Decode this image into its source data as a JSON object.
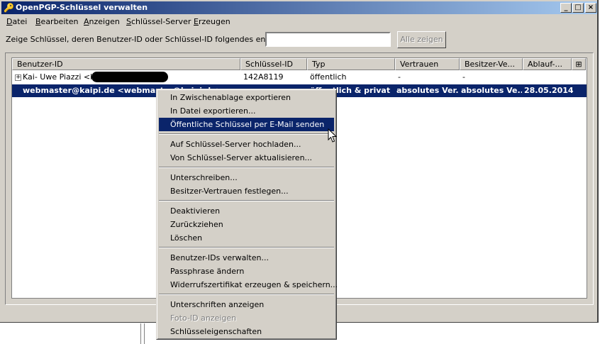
{
  "window": {
    "title": "OpenPGP-Schlüssel verwalten",
    "min": "_",
    "max": "□",
    "close": "×"
  },
  "menubar": [
    {
      "key": "D",
      "rest": "atei"
    },
    {
      "key": "B",
      "rest": "earbeiten"
    },
    {
      "key": "A",
      "rest": "nzeigen"
    },
    {
      "key": "S",
      "rest": "chlüssel-Server"
    },
    {
      "key": "E",
      "rest": "rzeugen"
    }
  ],
  "filter": {
    "label": "Zeige Schlüssel, deren Benutzer-ID oder Schlüssel-ID folgendes enthalten:",
    "value": "",
    "show_all": "Alle zeigen"
  },
  "columns": [
    "Benutzer-ID",
    "Schlüssel-ID",
    "Typ",
    "Vertrauen",
    "Besitzer-Ve...",
    "Ablauf-..."
  ],
  "rows": [
    {
      "expander": "+",
      "user": "Kai- Uwe Piazzi <kai-",
      "keyid": "142A8119",
      "type": "öffentlich",
      "trust": "-",
      "owner": "-",
      "expiry": ""
    },
    {
      "expander": "",
      "user": "webmaster@kaipi.de <webmaster@kaipi.de>",
      "keyid": "",
      "type": "öffentlich & privat",
      "trust": "absolutes Ver...",
      "owner": "absolutes Ve...",
      "expiry": "28.05.2014"
    }
  ],
  "context_menu": {
    "items": [
      "In Zwischenablage exportieren",
      "In Datei exportieren...",
      "Öffentliche Schlüssel per E-Mail senden",
      "Auf Schlüssel-Server hochladen...",
      "Von Schlüssel-Server aktualisieren...",
      "Unterschreiben...",
      "Besitzer-Vertrauen festlegen...",
      "Deaktivieren",
      "Zurückziehen",
      "Löschen",
      "Benutzer-IDs verwalten...",
      "Passphrase ändern",
      "Widerrufszertifikat erzeugen & speichern...",
      "Unterschriften anzeigen",
      "Foto-ID anzeigen",
      "Schlüsseleigenschaften"
    ]
  }
}
